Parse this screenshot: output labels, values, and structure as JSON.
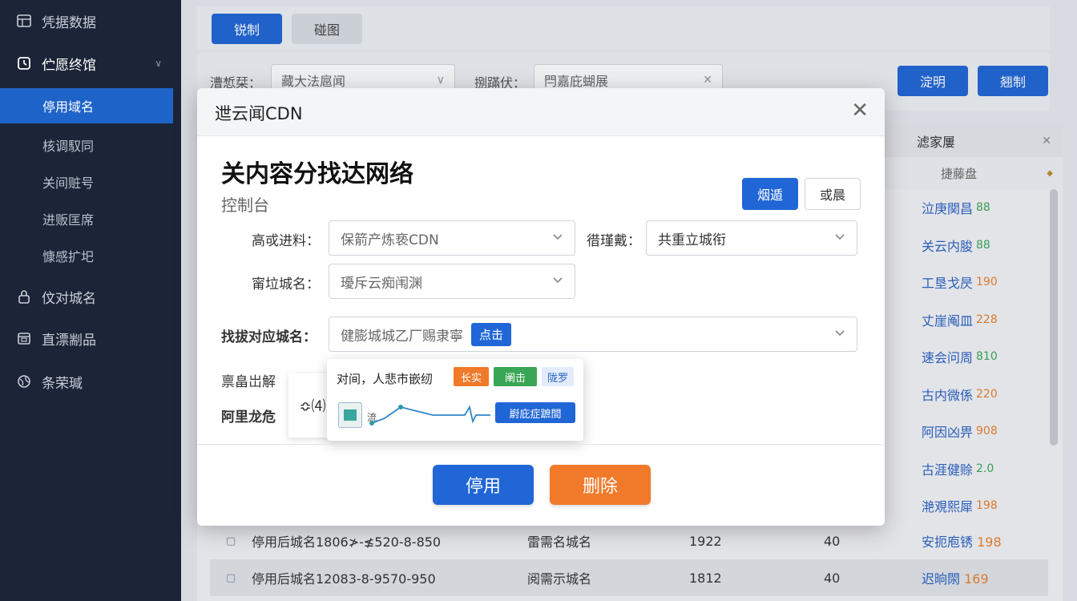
{
  "sidebar": {
    "items": [
      {
        "label": "凭据数据",
        "icon": "grid-icon"
      },
      {
        "label": "伫愿终馆",
        "icon": "clock-icon"
      },
      {
        "label": "伩对城名",
        "icon": "lock-icon"
      },
      {
        "label": "直漂剬品",
        "icon": "box-icon"
      },
      {
        "label": "条荣瑊",
        "icon": "globe-icon"
      }
    ],
    "subitems": [
      {
        "label": "停用域名",
        "active": true
      },
      {
        "label": "核调馭同"
      },
      {
        "label": "关间赃号"
      },
      {
        "label": "进贩匡席"
      },
      {
        "label": "慷感扩圯"
      }
    ]
  },
  "tabs": [
    {
      "label": "锐制",
      "active": true
    },
    {
      "label": "碰图"
    }
  ],
  "filters": {
    "label1": "漕惁栞：",
    "value1": "藏大法扈闻",
    "label2": "捌蹣伏：",
    "value2": "閂嘉庇蝴展",
    "btn_search": "淀明",
    "btn_create": "翘制"
  },
  "table": {
    "col_header": "滤家屢",
    "col_sub": "捷藤盘",
    "right_col": [
      {
        "text": "泣庚関昌",
        "badge": "88",
        "badge_color": "#3aa655"
      },
      {
        "text": "关云内朘",
        "badge": "88",
        "badge_color": "#3aa655"
      },
      {
        "text": "工垦戈昃",
        "badge": "190",
        "badge_color": "#e9812e"
      },
      {
        "text": "丈崖阄皿",
        "badge": "228",
        "badge_color": "#e9812e"
      },
      {
        "text": "速会问周",
        "badge": "810",
        "badge_color": "#3aa655"
      },
      {
        "text": "古内微係",
        "badge": "220",
        "badge_color": "#e9812e"
      },
      {
        "text": "阿因凶畀",
        "badge": "908",
        "badge_color": "#e9812e"
      },
      {
        "text": "古涯健赊",
        "badge": "2.0",
        "badge_color": "#3aa655"
      },
      {
        "text": "滟覌熙犀",
        "badge": "198",
        "badge_color": "#e9812e"
      }
    ],
    "bottom_rows": [
      {
        "icon": "lock-icon",
        "name": "停用后城名1806≯-≰520-8-850",
        "type": "雷需名城名",
        "num": "1922",
        "count": "40",
        "status": "安扼庖锈",
        "val": "198"
      },
      {
        "icon": "lock-icon",
        "name": "停用后城名12083-8-9570-950",
        "type": "阅需示城名",
        "num": "1812",
        "count": "40",
        "status": "迟晌閖",
        "val": "169"
      }
    ]
  },
  "modal": {
    "title": "迣云闻CDN",
    "heading": "关内容分找达网络",
    "subheading": "控制台",
    "btn_confirm": "烟遁",
    "btn_other": "或晨",
    "field1_label": "高戓进料：",
    "field1_value": "保箭产炼亵CDN",
    "field2_label": "徣瑾戴：",
    "field2_value": "共重立城衔",
    "field3_label": "甯垃城名：",
    "field3_value": "瓇斥云痴闱渊",
    "field4_label": "找拔对应城名：",
    "field4_value": "健膨城城乙厂赐隶寧",
    "field4_tag": "点击",
    "side_label1": "禀畠岀解",
    "side_label2": "阿里龙危",
    "popup_back_text": "≎⑷",
    "popup_title": "对间，人悲市嵌纫",
    "popup_tag1": "长实",
    "popup_tag2": "阐击",
    "popup_tag3": "陇罗",
    "popup_text": "流",
    "popup_btn": "嶎庇症蹠間",
    "btn_disable": "停用",
    "btn_delete": "删除"
  }
}
